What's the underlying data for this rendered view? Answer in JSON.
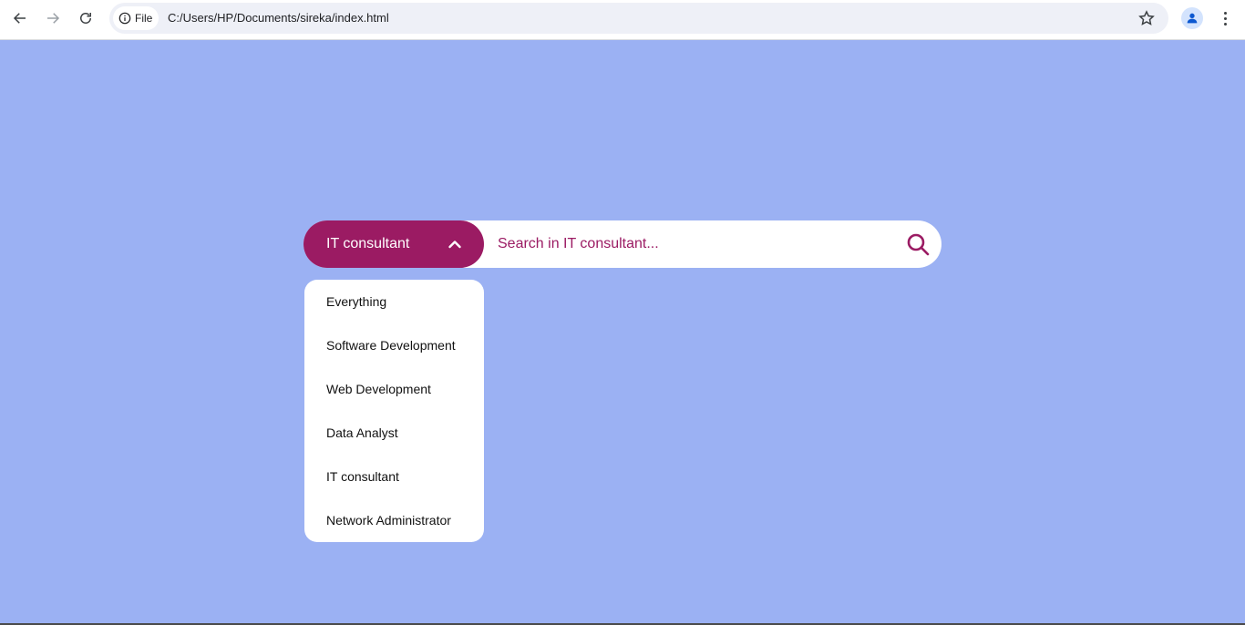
{
  "browser": {
    "back_icon": "arrow-left-icon",
    "forward_icon": "arrow-right-icon",
    "reload_icon": "reload-icon",
    "site_info_label": "File",
    "url": "C:/Users/HP/Documents/sireka/index.html",
    "bookmark_icon": "star-icon",
    "profile_icon": "person-icon",
    "menu_icon": "kebab-icon"
  },
  "search": {
    "selected_category": "IT consultant",
    "placeholder": "Search in IT consultant...",
    "value": "",
    "search_icon": "magnifier-icon"
  },
  "dropdown": {
    "open": true,
    "options": [
      "Everything",
      "Software Development",
      "Web Development",
      "Data Analyst",
      "IT consultant",
      "Network Administrator"
    ]
  },
  "colors": {
    "background": "#9bb1f3",
    "accent": "#9b1b63",
    "surface": "#ffffff"
  }
}
